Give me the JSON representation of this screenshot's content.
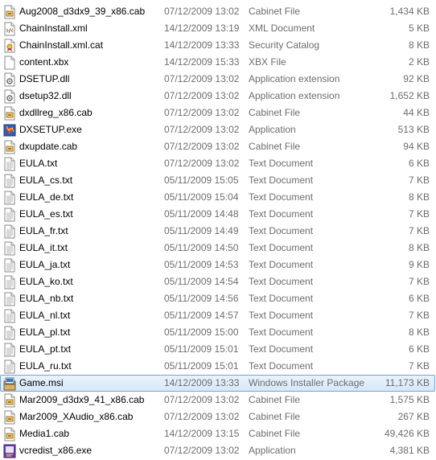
{
  "files": [
    {
      "name": "Aug2008_d3dx9_39_x86.cab",
      "date": "07/12/2009 13:02",
      "type": "Cabinet File",
      "size": "1,434 KB",
      "icon": "cabinet-icon"
    },
    {
      "name": "ChainInstall.xml",
      "date": "14/12/2009 13:19",
      "type": "XML Document",
      "size": "5 KB",
      "icon": "xml-document-icon"
    },
    {
      "name": "ChainInstall.xml.cat",
      "date": "14/12/2009 13:33",
      "type": "Security Catalog",
      "size": "8 KB",
      "icon": "security-catalog-icon"
    },
    {
      "name": "content.xbx",
      "date": "14/12/2009 15:33",
      "type": "XBX File",
      "size": "2 KB",
      "icon": "generic-file-icon"
    },
    {
      "name": "DSETUP.dll",
      "date": "07/12/2009 13:02",
      "type": "Application extension",
      "size": "92 KB",
      "icon": "dll-icon"
    },
    {
      "name": "dsetup32.dll",
      "date": "07/12/2009 13:02",
      "type": "Application extension",
      "size": "1,652 KB",
      "icon": "dll-icon"
    },
    {
      "name": "dxdllreg_x86.cab",
      "date": "07/12/2009 13:02",
      "type": "Cabinet File",
      "size": "44 KB",
      "icon": "cabinet-icon"
    },
    {
      "name": "DXSETUP.exe",
      "date": "07/12/2009 13:02",
      "type": "Application",
      "size": "513 KB",
      "icon": "dxsetup-app-icon"
    },
    {
      "name": "dxupdate.cab",
      "date": "07/12/2009 13:02",
      "type": "Cabinet File",
      "size": "94 KB",
      "icon": "cabinet-icon"
    },
    {
      "name": "EULA.txt",
      "date": "07/12/2009 13:02",
      "type": "Text Document",
      "size": "6 KB",
      "icon": "text-document-icon"
    },
    {
      "name": "EULA_cs.txt",
      "date": "05/11/2009 15:05",
      "type": "Text Document",
      "size": "7 KB",
      "icon": "text-document-icon"
    },
    {
      "name": "EULA_de.txt",
      "date": "05/11/2009 15:04",
      "type": "Text Document",
      "size": "8 KB",
      "icon": "text-document-icon"
    },
    {
      "name": "EULA_es.txt",
      "date": "05/11/2009 14:48",
      "type": "Text Document",
      "size": "7 KB",
      "icon": "text-document-icon"
    },
    {
      "name": "EULA_fr.txt",
      "date": "05/11/2009 14:49",
      "type": "Text Document",
      "size": "7 KB",
      "icon": "text-document-icon"
    },
    {
      "name": "EULA_it.txt",
      "date": "05/11/2009 14:50",
      "type": "Text Document",
      "size": "8 KB",
      "icon": "text-document-icon"
    },
    {
      "name": "EULA_ja.txt",
      "date": "05/11/2009 14:53",
      "type": "Text Document",
      "size": "9 KB",
      "icon": "text-document-icon"
    },
    {
      "name": "EULA_ko.txt",
      "date": "05/11/2009 14:54",
      "type": "Text Document",
      "size": "7 KB",
      "icon": "text-document-icon"
    },
    {
      "name": "EULA_nb.txt",
      "date": "05/11/2009 14:56",
      "type": "Text Document",
      "size": "6 KB",
      "icon": "text-document-icon"
    },
    {
      "name": "EULA_nl.txt",
      "date": "05/11/2009 14:57",
      "type": "Text Document",
      "size": "7 KB",
      "icon": "text-document-icon"
    },
    {
      "name": "EULA_pl.txt",
      "date": "05/11/2009 15:00",
      "type": "Text Document",
      "size": "8 KB",
      "icon": "text-document-icon"
    },
    {
      "name": "EULA_pt.txt",
      "date": "05/11/2009 15:01",
      "type": "Text Document",
      "size": "6 KB",
      "icon": "text-document-icon"
    },
    {
      "name": "EULA_ru.txt",
      "date": "05/11/2009 15:01",
      "type": "Text Document",
      "size": "7 KB",
      "icon": "text-document-icon"
    },
    {
      "name": "Game.msi",
      "date": "14/12/2009 13:33",
      "type": "Windows Installer Package",
      "size": "11,173 KB",
      "icon": "installer-package-icon",
      "selected": true
    },
    {
      "name": "Mar2009_d3dx9_41_x86.cab",
      "date": "07/12/2009 13:02",
      "type": "Cabinet File",
      "size": "1,575 KB",
      "icon": "cabinet-icon"
    },
    {
      "name": "Mar2009_XAudio_x86.cab",
      "date": "07/12/2009 13:02",
      "type": "Cabinet File",
      "size": "267 KB",
      "icon": "cabinet-icon"
    },
    {
      "name": "Media1.cab",
      "date": "14/12/2009 13:15",
      "type": "Cabinet File",
      "size": "49,426 KB",
      "icon": "cabinet-icon"
    },
    {
      "name": "vcredist_x86.exe",
      "date": "07/12/2009 13:02",
      "type": "Application",
      "size": "4,381 KB",
      "icon": "vcredist-app-icon"
    }
  ],
  "colors": {
    "text_primary": "#000000",
    "text_secondary": "#6d6d6d",
    "selection_border": "#7da2ce",
    "selection_fill": "#d7e8fb"
  }
}
